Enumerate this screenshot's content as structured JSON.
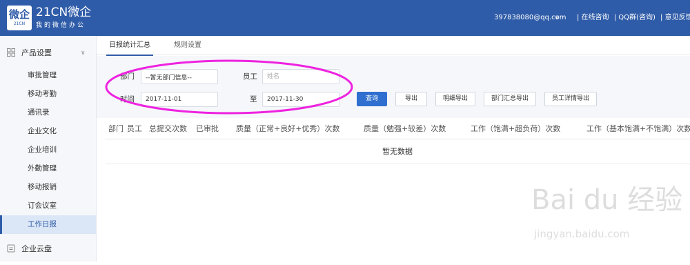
{
  "header": {
    "logo_char": "微企",
    "logo_sub": "21CN",
    "brand_name": "21CN微企",
    "brand_sub": "我的微信办公",
    "account": "397838080@qq.com",
    "account_caret": "∨",
    "links": [
      "| 在线咨询",
      "| QQ群(咨询)",
      "| 意见反馈"
    ],
    "bg_color": "#2f5ca8"
  },
  "sidebar": {
    "groups": [
      {
        "label": "产品设置",
        "icon": "grid-icon",
        "caret": "∨"
      },
      {
        "label": "企业云盘",
        "icon": "cloud-drive-icon"
      }
    ],
    "items": [
      {
        "label": "审批管理"
      },
      {
        "label": "移动考勤"
      },
      {
        "label": "通讯录"
      },
      {
        "label": "企业文化"
      },
      {
        "label": "企业培训"
      },
      {
        "label": "外勤管理"
      },
      {
        "label": "移动报销"
      },
      {
        "label": "订会议室"
      },
      {
        "label": "工作日报",
        "active": true
      }
    ]
  },
  "tabs": [
    {
      "label": "日报统计汇总",
      "active": true
    },
    {
      "label": "规则设置",
      "active": false
    }
  ],
  "filter": {
    "dept_label": "部门",
    "dept_value": "--暂无部门信息--",
    "emp_label": "员工",
    "emp_placeholder": "姓名",
    "time_label": "时间",
    "start_date": "2017-11-01",
    "to_label": "至",
    "end_date": "2017-11-30"
  },
  "buttons": {
    "query": "查询",
    "export": "导出",
    "detail_export": "明细导出",
    "dept_summary_export": "部门汇总导出",
    "emp_detail_export": "员工详情导出"
  },
  "table": {
    "columns": [
      "部门",
      "员工",
      "总提交次数",
      "已审批",
      "质量（正常+良好+优秀）次数",
      "质量（勉强+较差）次数",
      "工作（饱满+超负荷）次数",
      "工作（基本饱满+不饱满）次数"
    ],
    "empty_text": "暂无数据"
  },
  "annotation": {
    "color": "#ee22e0"
  },
  "watermark": {
    "main": "Bai du 经验",
    "sub": "jingyan.baidu.com"
  }
}
